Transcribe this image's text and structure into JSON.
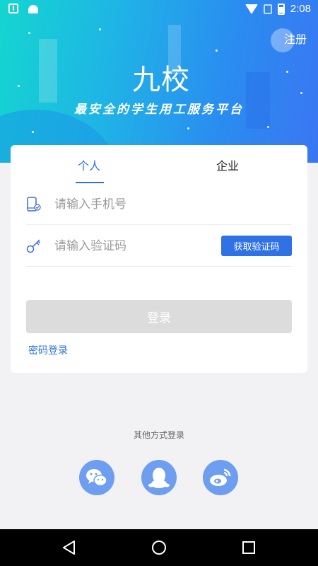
{
  "status_bar": {
    "time": "2:08"
  },
  "header": {
    "register_label": "注册",
    "logo_text": "九校",
    "tagline": "最安全的学生用工服务平台"
  },
  "tabs": [
    {
      "label": "个人",
      "active": true
    },
    {
      "label": "企业",
      "active": false
    }
  ],
  "form": {
    "phone_placeholder": "请输入手机号",
    "code_placeholder": "请输入验证码",
    "get_code_label": "获取验证码",
    "login_label": "登录",
    "password_login_label": "密码登录"
  },
  "other_login": {
    "label": "其他方式登录",
    "providers": [
      "wechat-icon",
      "qq-icon",
      "weibo-icon"
    ]
  },
  "colors": {
    "accent": "#2b73e0",
    "social_bg": "#6e9ef0",
    "login_disabled": "#dcdcdc"
  },
  "icons": {
    "nav": [
      "back-icon",
      "home-icon",
      "recents-icon"
    ]
  }
}
